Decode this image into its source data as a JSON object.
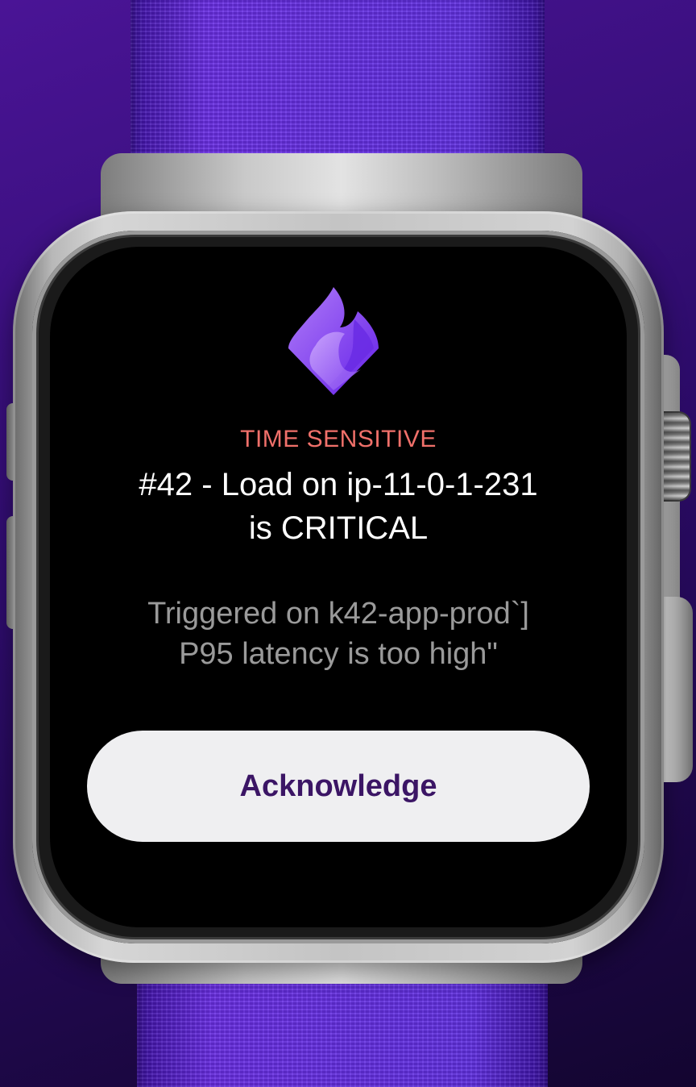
{
  "notification": {
    "badge": "TIME SENSITIVE",
    "title_line1": "#42 - Load on ip-11-0-1-231",
    "title_line2": "is CRITICAL",
    "body_line1": "Triggered on k42-app-prod`]",
    "body_line2": "P95 latency is too high\"",
    "action_label": "Acknowledge"
  },
  "app_icon": "flame-icon",
  "colors": {
    "badge": "#f0706a",
    "title": "#ffffff",
    "body": "#9a9a9a",
    "button_bg": "#efeff1",
    "button_text": "#3b1565",
    "band": "#5a20d8",
    "background": "#2e0c6c",
    "icon_gradient_start": "#b07cf8",
    "icon_gradient_end": "#6420e8"
  }
}
